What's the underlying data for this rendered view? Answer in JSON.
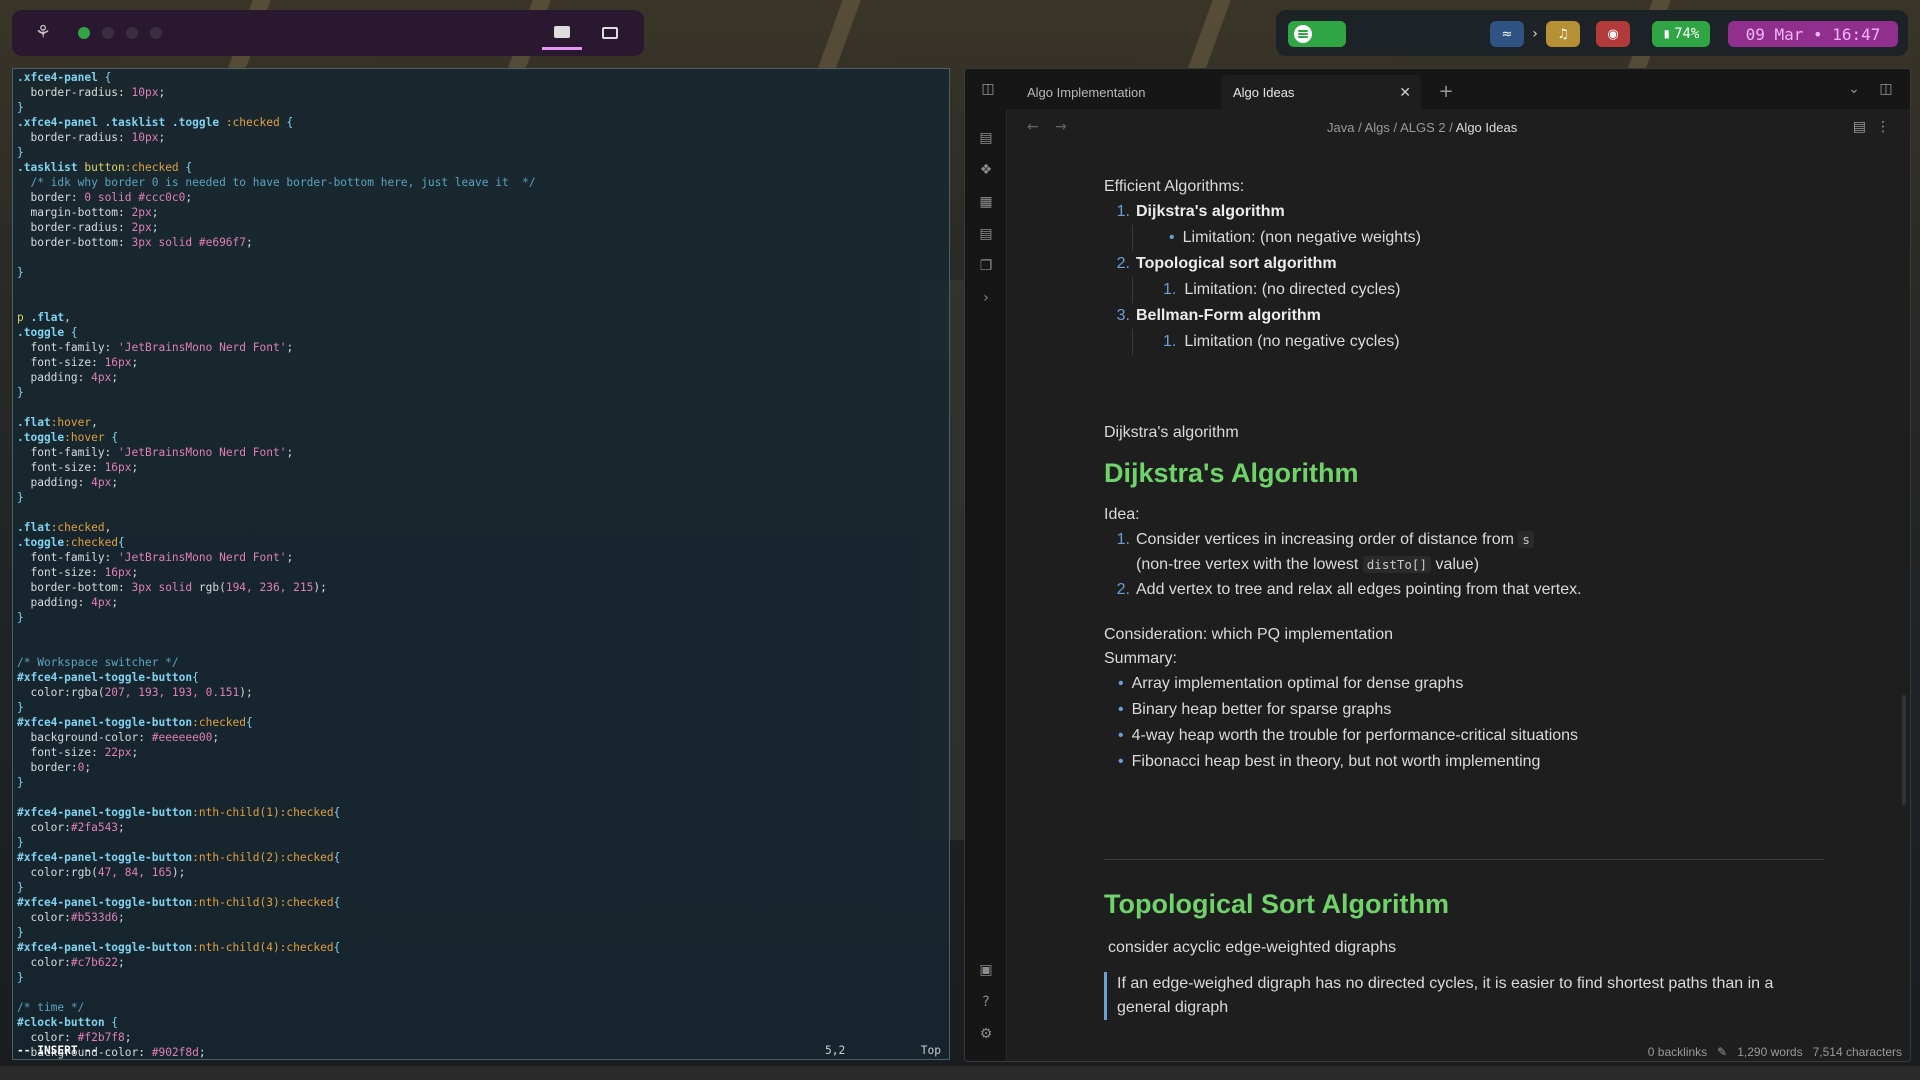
{
  "topbar": {
    "workspaces": [
      {
        "active": true
      },
      {
        "active": false
      },
      {
        "active": false
      },
      {
        "active": false
      }
    ],
    "battery": "74%",
    "clock": "09 Mar • 16:47",
    "chevron": "›",
    "colors": {
      "ws_active": "#2fa543",
      "clock_bg": "#902f8d",
      "clock_fg": "#f2b7f8",
      "batt_bg": "#2fa543",
      "vol_bg": "#b33a3a",
      "bell_bg": "#b59035",
      "wifi_bg": "#2f5484"
    }
  },
  "terminal": {
    "lines": [
      [
        [
          "sel",
          ".xfce4-panel "
        ],
        [
          "brace",
          "{"
        ]
      ],
      [
        [
          "prop",
          "  border-radius: "
        ],
        [
          "val",
          "10px"
        ],
        [
          "prop",
          ";"
        ]
      ],
      [
        [
          "brace",
          "}"
        ]
      ],
      [
        [
          "sel",
          ".xfce4-panel .tasklist .toggle "
        ],
        [
          "pseudo",
          ":checked "
        ],
        [
          "brace",
          "{"
        ]
      ],
      [
        [
          "prop",
          "  border-radius: "
        ],
        [
          "val",
          "10px"
        ],
        [
          "prop",
          ";"
        ]
      ],
      [
        [
          "brace",
          "}"
        ]
      ],
      [
        [
          "sel",
          ".tasklist "
        ],
        [
          "kw",
          "button"
        ],
        [
          "pseudo",
          ":checked "
        ],
        [
          "brace",
          "{"
        ]
      ],
      [
        [
          "cmt",
          "  /* idk why border 0 is needed to have border-bottom here, just leave it  */"
        ]
      ],
      [
        [
          "prop",
          "  border: "
        ],
        [
          "val",
          "0 solid #ccc0c0"
        ],
        [
          "prop",
          ";"
        ]
      ],
      [
        [
          "prop",
          "  margin-bottom: "
        ],
        [
          "val",
          "2px"
        ],
        [
          "prop",
          ";"
        ]
      ],
      [
        [
          "prop",
          "  border-radius: "
        ],
        [
          "val",
          "2px"
        ],
        [
          "prop",
          ";"
        ]
      ],
      [
        [
          "prop",
          "  border-bottom: "
        ],
        [
          "val",
          "3px solid #e696f7"
        ],
        [
          "prop",
          ";"
        ]
      ],
      [
        [
          "prop",
          ""
        ]
      ],
      [
        [
          "brace",
          "}"
        ]
      ],
      [
        [
          "prop",
          ""
        ]
      ],
      [
        [
          "prop",
          ""
        ]
      ],
      [
        [
          "kw",
          "p "
        ],
        [
          "sel",
          ".flat"
        ],
        [
          "prop",
          ","
        ]
      ],
      [
        [
          "sel",
          ".toggle "
        ],
        [
          "brace",
          "{"
        ]
      ],
      [
        [
          "prop",
          "  font-family: "
        ],
        [
          "str",
          "'JetBrainsMono Nerd Font'"
        ],
        [
          "prop",
          ";"
        ]
      ],
      [
        [
          "prop",
          "  font-size: "
        ],
        [
          "val",
          "16px"
        ],
        [
          "prop",
          ";"
        ]
      ],
      [
        [
          "prop",
          "  padding: "
        ],
        [
          "val",
          "4px"
        ],
        [
          "prop",
          ";"
        ]
      ],
      [
        [
          "brace",
          "}"
        ]
      ],
      [
        [
          "prop",
          ""
        ]
      ],
      [
        [
          "sel",
          ".flat"
        ],
        [
          "pseudo",
          ":hover"
        ],
        [
          "prop",
          ","
        ]
      ],
      [
        [
          "sel",
          ".toggle"
        ],
        [
          "pseudo",
          ":hover "
        ],
        [
          "brace",
          "{"
        ]
      ],
      [
        [
          "prop",
          "  font-family: "
        ],
        [
          "str",
          "'JetBrainsMono Nerd Font'"
        ],
        [
          "prop",
          ";"
        ]
      ],
      [
        [
          "prop",
          "  font-size: "
        ],
        [
          "val",
          "16px"
        ],
        [
          "prop",
          ";"
        ]
      ],
      [
        [
          "prop",
          "  padding: "
        ],
        [
          "val",
          "4px"
        ],
        [
          "prop",
          ";"
        ]
      ],
      [
        [
          "brace",
          "}"
        ]
      ],
      [
        [
          "prop",
          ""
        ]
      ],
      [
        [
          "sel",
          ".flat"
        ],
        [
          "pseudo",
          ":checked"
        ],
        [
          "prop",
          ","
        ]
      ],
      [
        [
          "sel",
          ".toggle"
        ],
        [
          "pseudo",
          ":checked"
        ],
        [
          "brace",
          "{"
        ]
      ],
      [
        [
          "prop",
          "  font-family: "
        ],
        [
          "str",
          "'JetBrainsMono Nerd Font'"
        ],
        [
          "prop",
          ";"
        ]
      ],
      [
        [
          "prop",
          "  font-size: "
        ],
        [
          "val",
          "16px"
        ],
        [
          "prop",
          ";"
        ]
      ],
      [
        [
          "prop",
          "  border-bottom: "
        ],
        [
          "val",
          "3px solid "
        ],
        [
          "prop",
          "rgb("
        ],
        [
          "val",
          "194, 236, 215"
        ],
        [
          "prop",
          ");"
        ]
      ],
      [
        [
          "prop",
          "  padding: "
        ],
        [
          "val",
          "4px"
        ],
        [
          "prop",
          ";"
        ]
      ],
      [
        [
          "brace",
          "}"
        ]
      ],
      [
        [
          "prop",
          ""
        ]
      ],
      [
        [
          "prop",
          ""
        ]
      ],
      [
        [
          "cmt",
          "/* Workspace switcher */"
        ]
      ],
      [
        [
          "sel",
          "#xfce4-panel-toggle-button"
        ],
        [
          "brace",
          "{"
        ]
      ],
      [
        [
          "prop",
          "  color:rgba("
        ],
        [
          "val",
          "207, 193, 193, 0.151"
        ],
        [
          "prop",
          ");"
        ]
      ],
      [
        [
          "brace",
          "}"
        ]
      ],
      [
        [
          "sel",
          "#xfce4-panel-toggle-button"
        ],
        [
          "pseudo",
          ":checked"
        ],
        [
          "brace",
          "{"
        ]
      ],
      [
        [
          "prop",
          "  background-color: "
        ],
        [
          "val",
          "#eeeeee00"
        ],
        [
          "prop",
          ";"
        ]
      ],
      [
        [
          "prop",
          "  font-size: "
        ],
        [
          "val",
          "22px"
        ],
        [
          "prop",
          ";"
        ]
      ],
      [
        [
          "prop",
          "  border:"
        ],
        [
          "val",
          "0"
        ],
        [
          "prop",
          ";"
        ]
      ],
      [
        [
          "brace",
          "}"
        ]
      ],
      [
        [
          "prop",
          ""
        ]
      ],
      [
        [
          "sel",
          "#xfce4-panel-toggle-button"
        ],
        [
          "pseudo",
          ":nth-child(1):checked"
        ],
        [
          "brace",
          "{"
        ]
      ],
      [
        [
          "prop",
          "  color:"
        ],
        [
          "val",
          "#2fa543"
        ],
        [
          "prop",
          ";"
        ]
      ],
      [
        [
          "brace",
          "}"
        ]
      ],
      [
        [
          "sel",
          "#xfce4-panel-toggle-button"
        ],
        [
          "pseudo",
          ":nth-child(2):checked"
        ],
        [
          "brace",
          "{"
        ]
      ],
      [
        [
          "prop",
          "  color:rgb("
        ],
        [
          "val",
          "47, 84, 165"
        ],
        [
          "prop",
          ");"
        ]
      ],
      [
        [
          "brace",
          "}"
        ]
      ],
      [
        [
          "sel",
          "#xfce4-panel-toggle-button"
        ],
        [
          "pseudo",
          ":nth-child(3):checked"
        ],
        [
          "brace",
          "{"
        ]
      ],
      [
        [
          "prop",
          "  color:"
        ],
        [
          "val",
          "#b533d6"
        ],
        [
          "prop",
          ";"
        ]
      ],
      [
        [
          "brace",
          "}"
        ]
      ],
      [
        [
          "sel",
          "#xfce4-panel-toggle-button"
        ],
        [
          "pseudo",
          ":nth-child(4):checked"
        ],
        [
          "brace",
          "{"
        ]
      ],
      [
        [
          "prop",
          "  color:"
        ],
        [
          "val",
          "#c7b622"
        ],
        [
          "prop",
          ";"
        ]
      ],
      [
        [
          "brace",
          "}"
        ]
      ],
      [
        [
          "prop",
          ""
        ]
      ],
      [
        [
          "cmt",
          "/* time */"
        ]
      ],
      [
        [
          "sel",
          "#clock-button "
        ],
        [
          "brace",
          "{"
        ]
      ],
      [
        [
          "prop",
          "  color: "
        ],
        [
          "val",
          "#f2b7f8"
        ],
        [
          "prop",
          ";"
        ]
      ],
      [
        [
          "prop",
          "  background-color: "
        ],
        [
          "val",
          "#902f8d"
        ],
        [
          "prop",
          ";"
        ]
      ]
    ],
    "mode": "-- INSERT --",
    "position": "5,2",
    "scroll": "Top"
  },
  "obsidian": {
    "tabs": [
      {
        "label": "Algo Implementation",
        "active": false
      },
      {
        "label": "Algo Ideas",
        "active": true
      }
    ],
    "breadcrumb": [
      "Java",
      "Algs",
      "ALGS 2",
      "Algo Ideas"
    ],
    "breadcrumb_sep": "/",
    "intro": "Efficient Algorithms:",
    "algos": [
      {
        "n": "1.",
        "name": "Dijkstra's algorithm",
        "sub_marker": "•",
        "sub": "Limitation: (non negative weights)"
      },
      {
        "n": "2.",
        "name": "Topological sort algorithm",
        "sub_marker": "1.",
        "sub": "Limitation: (no directed cycles)"
      },
      {
        "n": "3.",
        "name": "Bellman-Form algorithm",
        "sub_marker": "1.",
        "sub": "Limitation (no negative cycles)"
      }
    ],
    "dijkstra_label": "Dijkstra's algorithm",
    "h_dijkstra": "Dijkstra's Algorithm",
    "idea_label": "Idea:",
    "idea1_a": "Consider vertices in increasing order of distance from",
    "idea1_code": "s",
    "idea1_b": "(non-tree vertex with the lowest",
    "idea1_code2": "distTo[]",
    "idea1_c": "value)",
    "idea2": "Add vertex to tree and relax all edges pointing from that vertex.",
    "consideration": "Consideration: which PQ implementation",
    "summary": "Summary:",
    "summary_items": [
      "Array implementation optimal for dense graphs",
      "Binary heap better for sparse graphs",
      "4-way heap worth the trouble for performance-critical situations",
      "Fibonacci heap best in theory, but not worth implementing"
    ],
    "h_topo": "Topological Sort Algorithm",
    "topo_line": "consider acyclic edge-weighted digraphs",
    "topo_quote": "If an edge-weighed digraph has no directed cycles, it is easier to find shortest paths than in a general digraph",
    "footer": {
      "backlinks": "0 backlinks",
      "words": "1,290 words",
      "chars": "7,514 characters"
    }
  }
}
